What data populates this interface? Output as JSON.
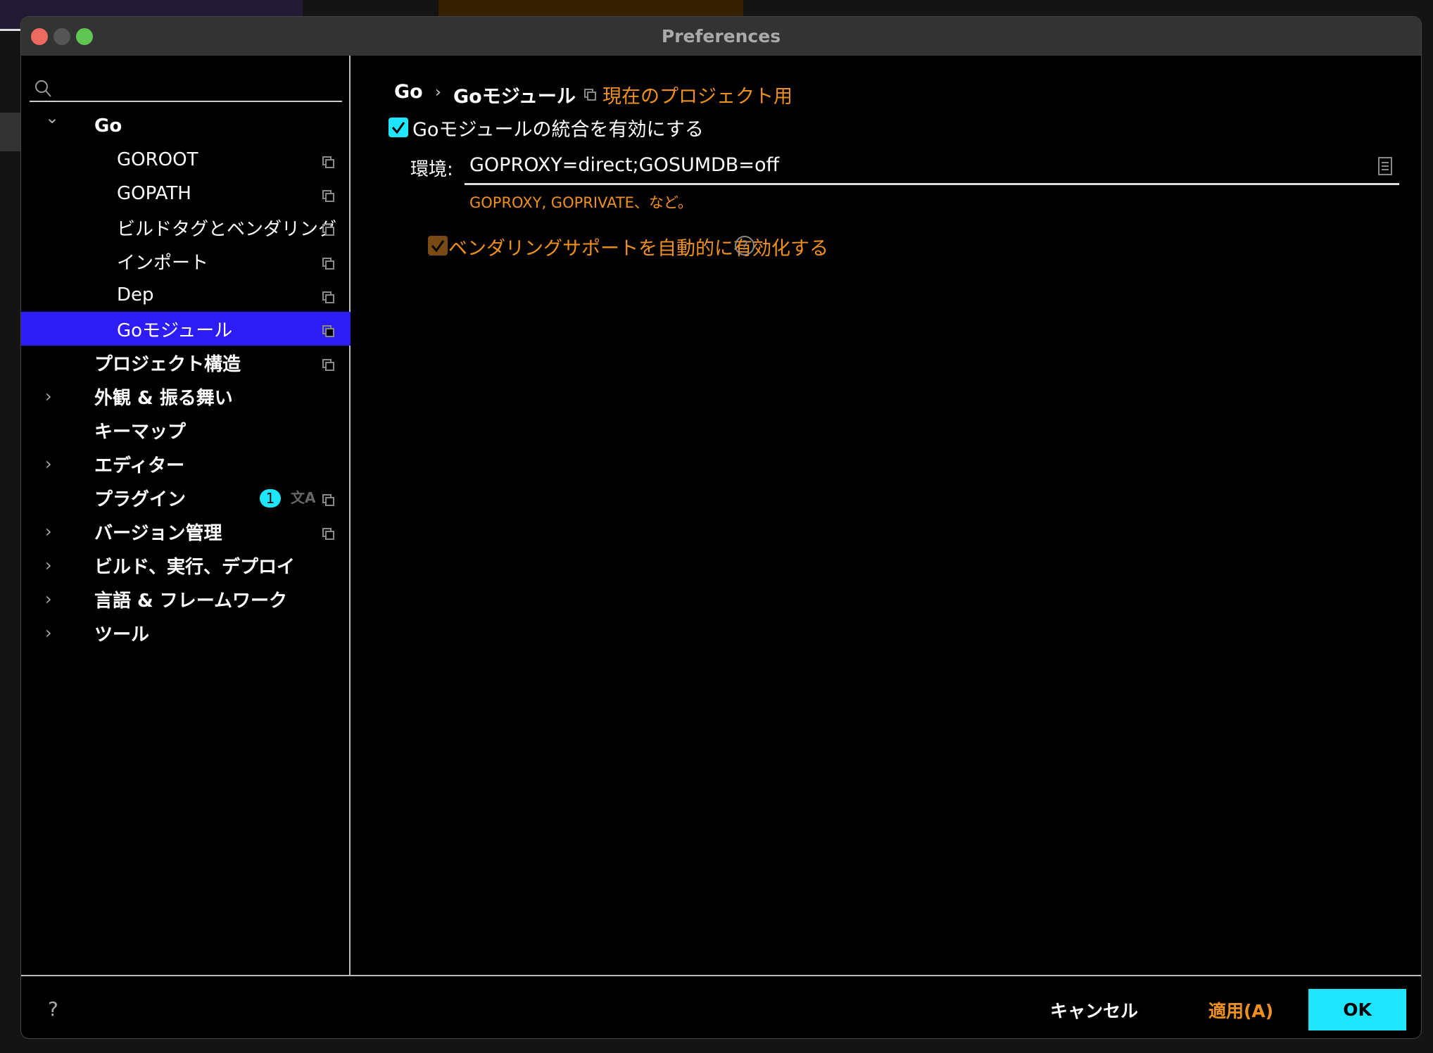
{
  "window": {
    "title": "Preferences"
  },
  "sidebar": {
    "search_placeholder": "",
    "items": [
      {
        "label": "Go",
        "level": 0,
        "expanded": true
      },
      {
        "label": "GOROOT",
        "level": 1
      },
      {
        "label": "GOPATH",
        "level": 1
      },
      {
        "label": "ビルドタグとベンダリング",
        "level": 1
      },
      {
        "label": "インポート",
        "level": 1
      },
      {
        "label": "Dep",
        "level": 1
      },
      {
        "label": "Goモジュール",
        "level": 1,
        "selected": true
      },
      {
        "label": "プロジェクト構造",
        "level": 0
      },
      {
        "label": "外観 & 振る舞い",
        "level": 0
      },
      {
        "label": "キーマップ",
        "level": 0
      },
      {
        "label": "エディター",
        "level": 0
      },
      {
        "label": "プラグイン",
        "level": 0,
        "badge": "1"
      },
      {
        "label": "バージョン管理",
        "level": 0
      },
      {
        "label": "ビルド、実行、デプロイ",
        "level": 0
      },
      {
        "label": "言語 & フレームワーク",
        "level": 0
      },
      {
        "label": "ツール",
        "level": 0
      }
    ]
  },
  "main": {
    "breadcrumb": [
      "Go",
      "Goモジュール"
    ],
    "breadcrumb_sep": "›",
    "scope": "現在のプロジェクト用",
    "enable_modules_label": "Goモジュールの統合を有効にする",
    "env_label": "環境:",
    "env_value": "GOPROXY=direct;GOSUMDB=off",
    "env_hint": "GOPROXY, GOPRIVATE、など。",
    "vendoring_label": "ベンダリングサポートを自動的に有効化する",
    "help": "?"
  },
  "footer": {
    "help": "?",
    "cancel": "キャンセル",
    "apply": "適用(A)",
    "ok": "OK"
  },
  "colors": {
    "accent": "#1ee6ff",
    "selection": "#2d1cf5",
    "modified": "#f0901e"
  }
}
